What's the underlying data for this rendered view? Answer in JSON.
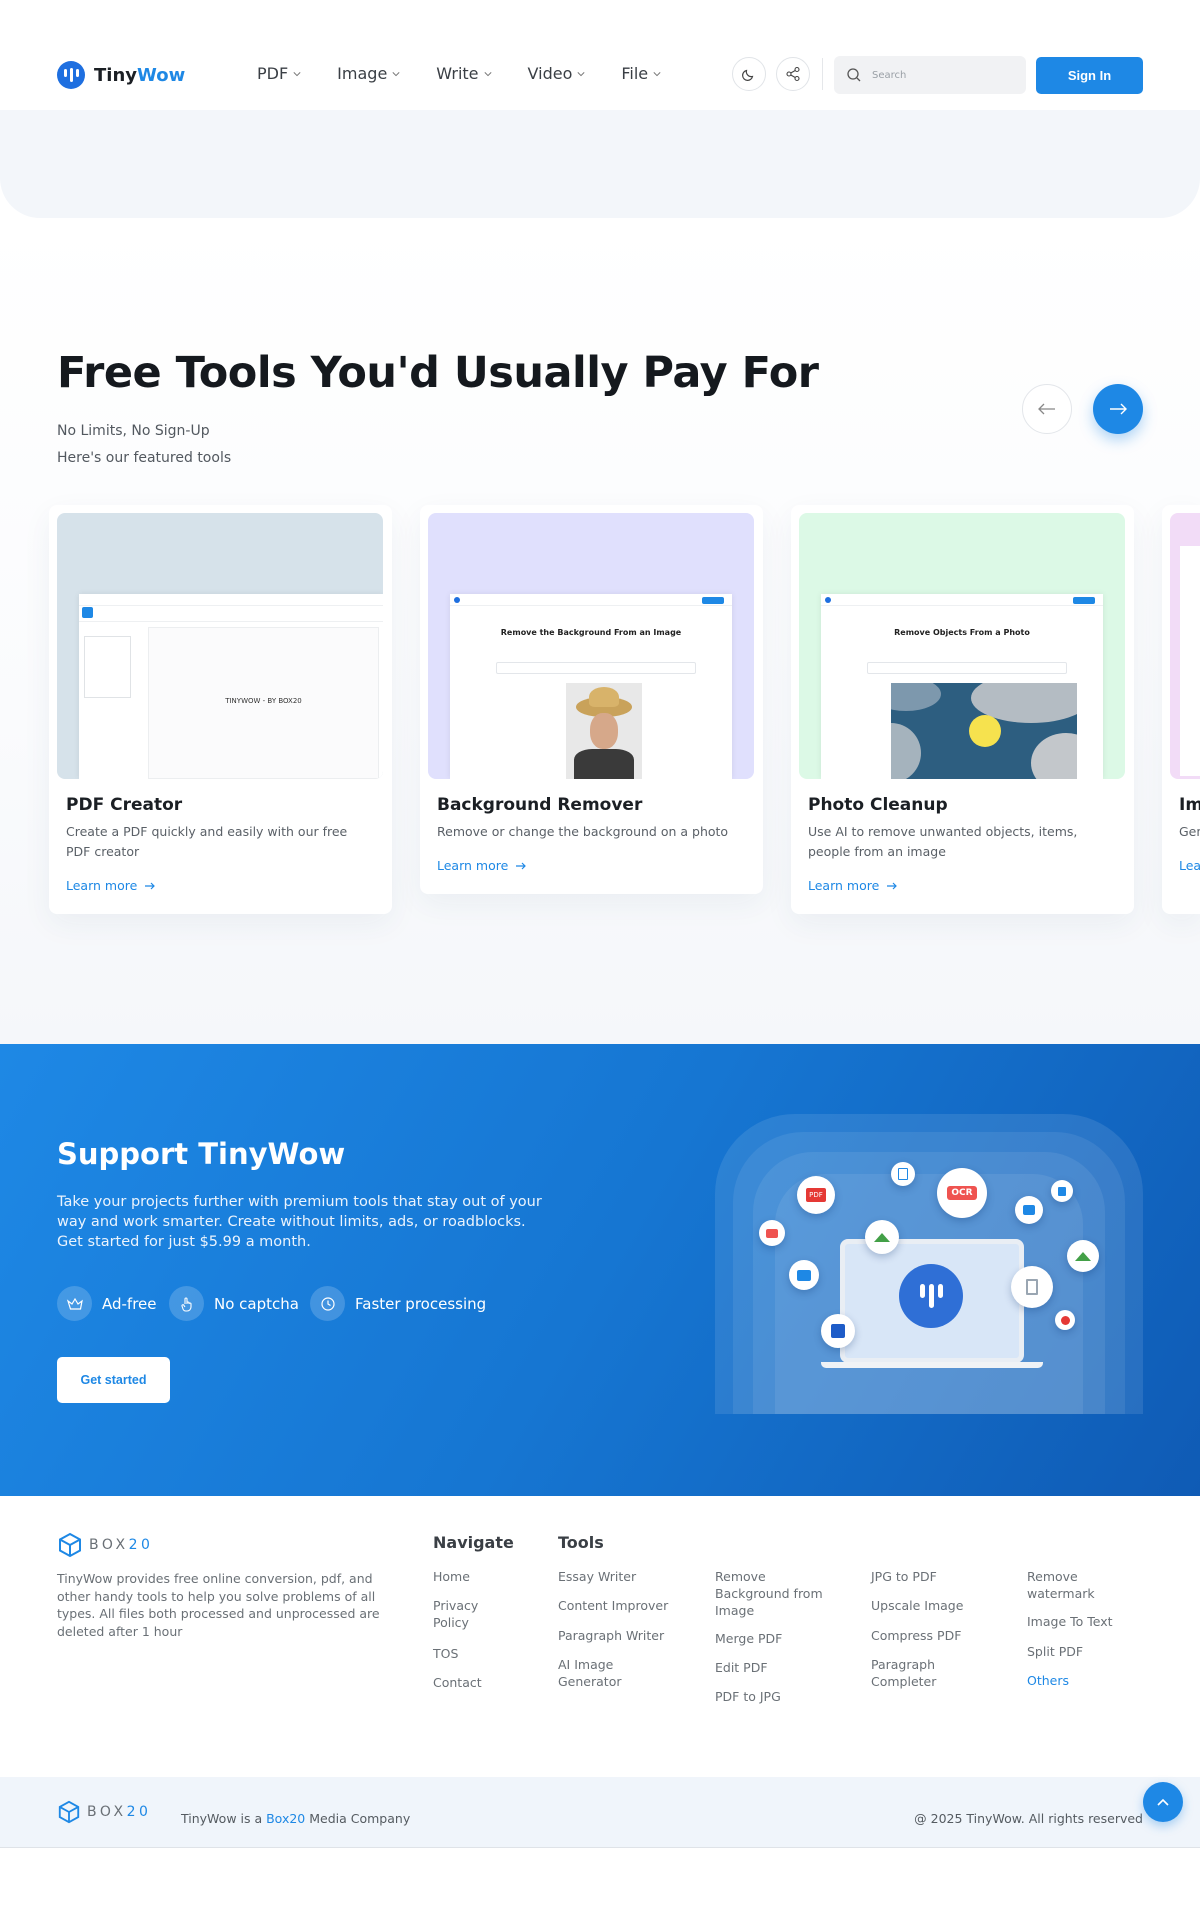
{
  "header": {
    "logo_prefix": "Tiny",
    "logo_suffix": "Wow",
    "nav": [
      "PDF",
      "Image",
      "Write",
      "Video",
      "File"
    ],
    "search_placeholder": "Search",
    "signin_label": "Sign In"
  },
  "featured": {
    "title": "Free Tools You'd Usually Pay For",
    "sub1": "No Limits, No Sign-Up",
    "sub2": "Here's our featured tools",
    "cards": [
      {
        "title": "PDF Creator",
        "desc": "Create a PDF quickly and easily with our free PDF creator",
        "link": "Learn more",
        "bg": "#d6e2ea",
        "preview_text": "TINYWOW - BY BOX20"
      },
      {
        "title": "Background Remover",
        "desc": "Remove or change the background on a photo",
        "link": "Learn more",
        "bg": "#e0e0fd",
        "preview_text": "Remove the Background From an Image"
      },
      {
        "title": "Photo Cleanup",
        "desc": "Use AI to remove unwanted objects, items, people from an image",
        "link": "Learn more",
        "bg": "#dcf9e6",
        "preview_text": "Remove Objects From a Photo"
      },
      {
        "title": "Im",
        "desc": "Gen",
        "link": "Lea",
        "bg": "#f2dcf7"
      }
    ]
  },
  "support": {
    "title": "Support TinyWow",
    "text": "Take your projects further with premium tools that stay out of your way and work smarter. Create without limits, ads, or roadblocks. Get started for just $5.99 a month.",
    "features": [
      "Ad-free",
      "No captcha",
      "Faster processing"
    ],
    "cta": "Get started",
    "ocr_label": "OCR",
    "pdf_label": "PDF"
  },
  "footer": {
    "brand": "BOX",
    "brand_num": "20",
    "desc": "TinyWow provides free online conversion, pdf, and other handy tools to help you solve problems of all types. All files both processed and unprocessed are deleted after 1 hour",
    "navigate_title": "Navigate",
    "navigate": [
      "Home",
      "Privacy Policy",
      "TOS",
      "Contact"
    ],
    "tools_title": "Tools",
    "tools_col1": [
      "Essay Writer",
      "Content Improver",
      "Paragraph Writer",
      "AI Image Generator"
    ],
    "tools_col2": [
      "Remove Background from Image",
      "Merge PDF",
      "Edit PDF",
      "PDF to JPG"
    ],
    "tools_col3": [
      "JPG to PDF",
      "Upscale Image",
      "Compress PDF",
      "Paragraph Completer"
    ],
    "tools_col4": [
      "Remove watermark",
      "Image To Text",
      "Split PDF",
      "Others"
    ],
    "company_prefix": "TinyWow is a ",
    "company_link": "Box20",
    "company_suffix": " Media Company",
    "copyright": "@ 2025 TinyWow. All rights reserved"
  },
  "colors": {
    "accent": "#1e88e5",
    "support_dark": "#0f5bb5"
  }
}
